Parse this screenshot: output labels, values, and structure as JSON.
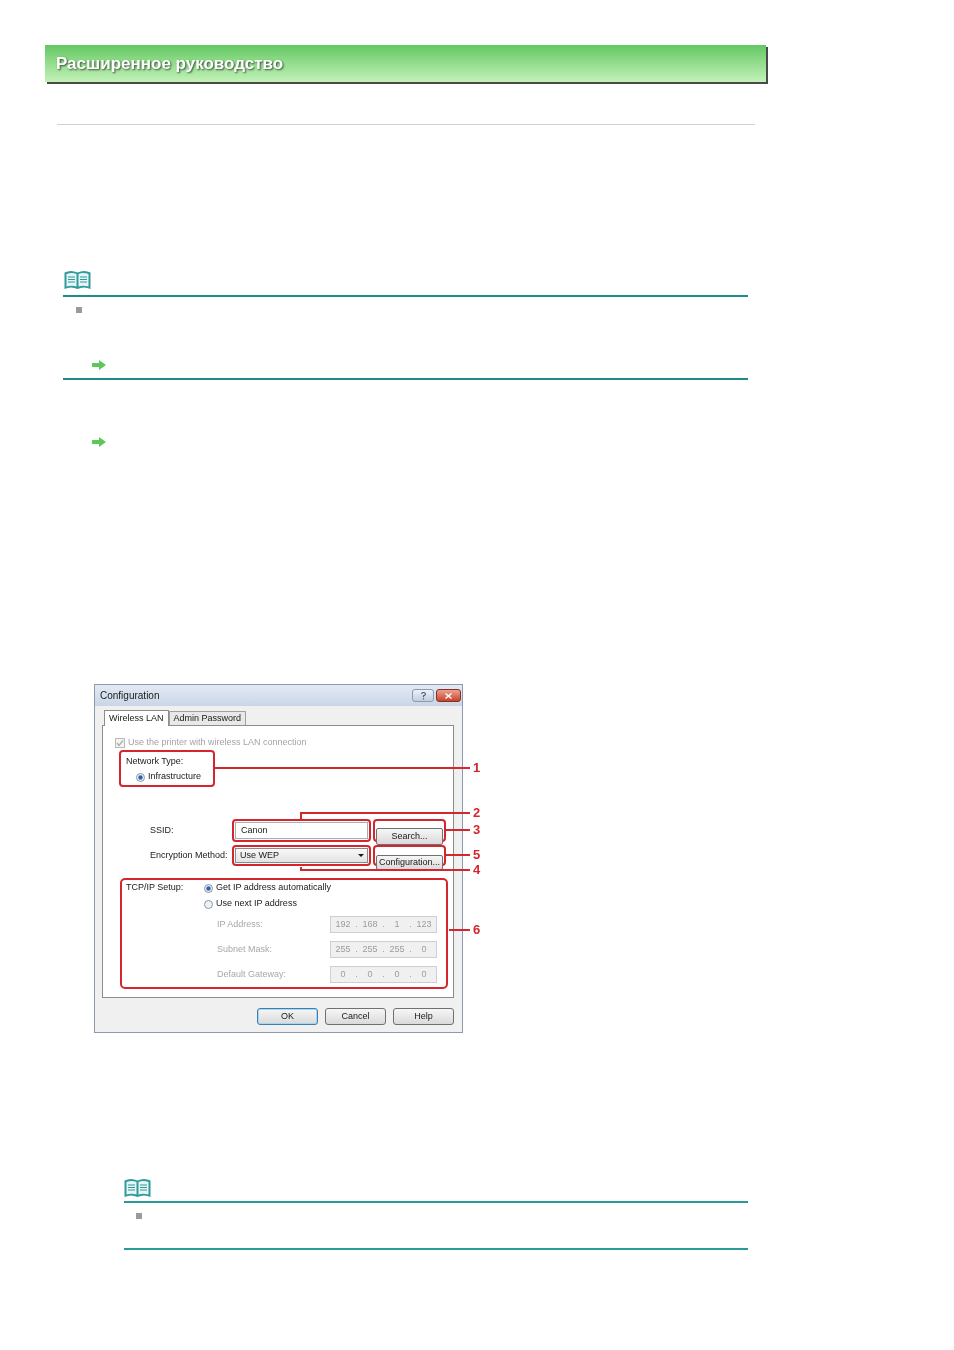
{
  "header": {
    "title": "Расширенное руководство"
  },
  "dialog": {
    "title": "Configuration",
    "tabs": [
      {
        "label": "Wireless LAN",
        "selected": true
      },
      {
        "label": "Admin Password",
        "selected": false
      }
    ],
    "wireless_checkbox": {
      "label": "Use the printer with wireless LAN connection",
      "checked": true,
      "disabled": true
    },
    "network_type": {
      "label": "Network Type:",
      "options": [
        {
          "label": "Infrastructure",
          "selected": true
        }
      ]
    },
    "ssid": {
      "label": "SSID:",
      "value": "Canon"
    },
    "search_button": {
      "label": "Search..."
    },
    "encryption": {
      "label": "Encryption Method:",
      "value": "Use WEP"
    },
    "configuration_button": {
      "label": "Configuration..."
    },
    "tcpip": {
      "label": "TCP/IP Setup:",
      "options": [
        {
          "label": "Get IP address automatically",
          "selected": true
        },
        {
          "label": "Use next IP address",
          "selected": false
        }
      ],
      "separator": ".",
      "fields": [
        {
          "label": "IP Address:",
          "octets": [
            "192",
            "168",
            "1",
            "123"
          ],
          "disabled": true
        },
        {
          "label": "Subnet Mask:",
          "octets": [
            "255",
            "255",
            "255",
            "0"
          ],
          "disabled": true
        },
        {
          "label": "Default Gateway:",
          "octets": [
            "0",
            "0",
            "0",
            "0"
          ],
          "disabled": true
        }
      ]
    },
    "buttons": [
      {
        "label": "OK",
        "default": true
      },
      {
        "label": "Cancel",
        "default": false
      },
      {
        "label": "Help",
        "default": false
      }
    ]
  },
  "callouts": [
    "1",
    "2",
    "3",
    "5",
    "4",
    "6"
  ]
}
